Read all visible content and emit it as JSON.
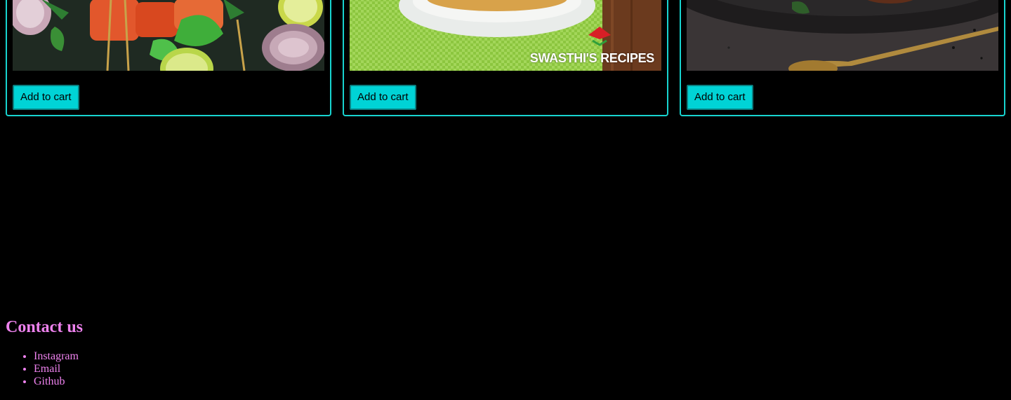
{
  "products": [
    {
      "add_to_cart_label": "Add to cart",
      "image_subject": "paneer-tikka-skewers-photo"
    },
    {
      "add_to_cart_label": "Add to cart",
      "image_subject": "rice-bowl-photo",
      "watermark_text": "SWASTHI'S RECIPES"
    },
    {
      "add_to_cart_label": "Add to cart",
      "image_subject": "dish-with-spoon-photo"
    }
  ],
  "footer": {
    "heading": "Contact us",
    "links": [
      "Instagram",
      "Email",
      "Github"
    ]
  },
  "colors": {
    "background": "#000000",
    "card_border": "#18d4d0",
    "button_bg": "#00d3d6",
    "footer_text": "#ee82ee"
  }
}
